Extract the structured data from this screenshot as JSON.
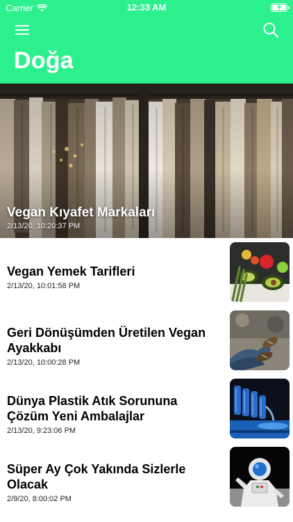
{
  "status_bar": {
    "carrier": "Carrier",
    "time": "12:33 AM"
  },
  "header": {
    "title": "Doğa",
    "menu_icon": "hamburger-menu-icon",
    "search_icon": "search-icon",
    "color": "#2cf08e"
  },
  "featured": {
    "title": "Vegan Kıyafet Markaları",
    "date": "2/13/20, 10:20:37 PM"
  },
  "articles": [
    {
      "title": "Vegan Yemek Tarifleri",
      "date": "2/13/20, 10:01:58 PM"
    },
    {
      "title": "Geri Dönüşümden Üretilen Vegan Ayakkabı",
      "date": "2/13/20, 10:00:28 PM"
    },
    {
      "title": "Dünya Plastik Atık Sorununa Çözüm Yeni Ambalajlar",
      "date": "2/13/20, 9:23:06 PM"
    },
    {
      "title": "Süper Ay Çok Yakında Sizlerle Olacak",
      "date": "2/9/20, 8:00:02 PM"
    }
  ]
}
